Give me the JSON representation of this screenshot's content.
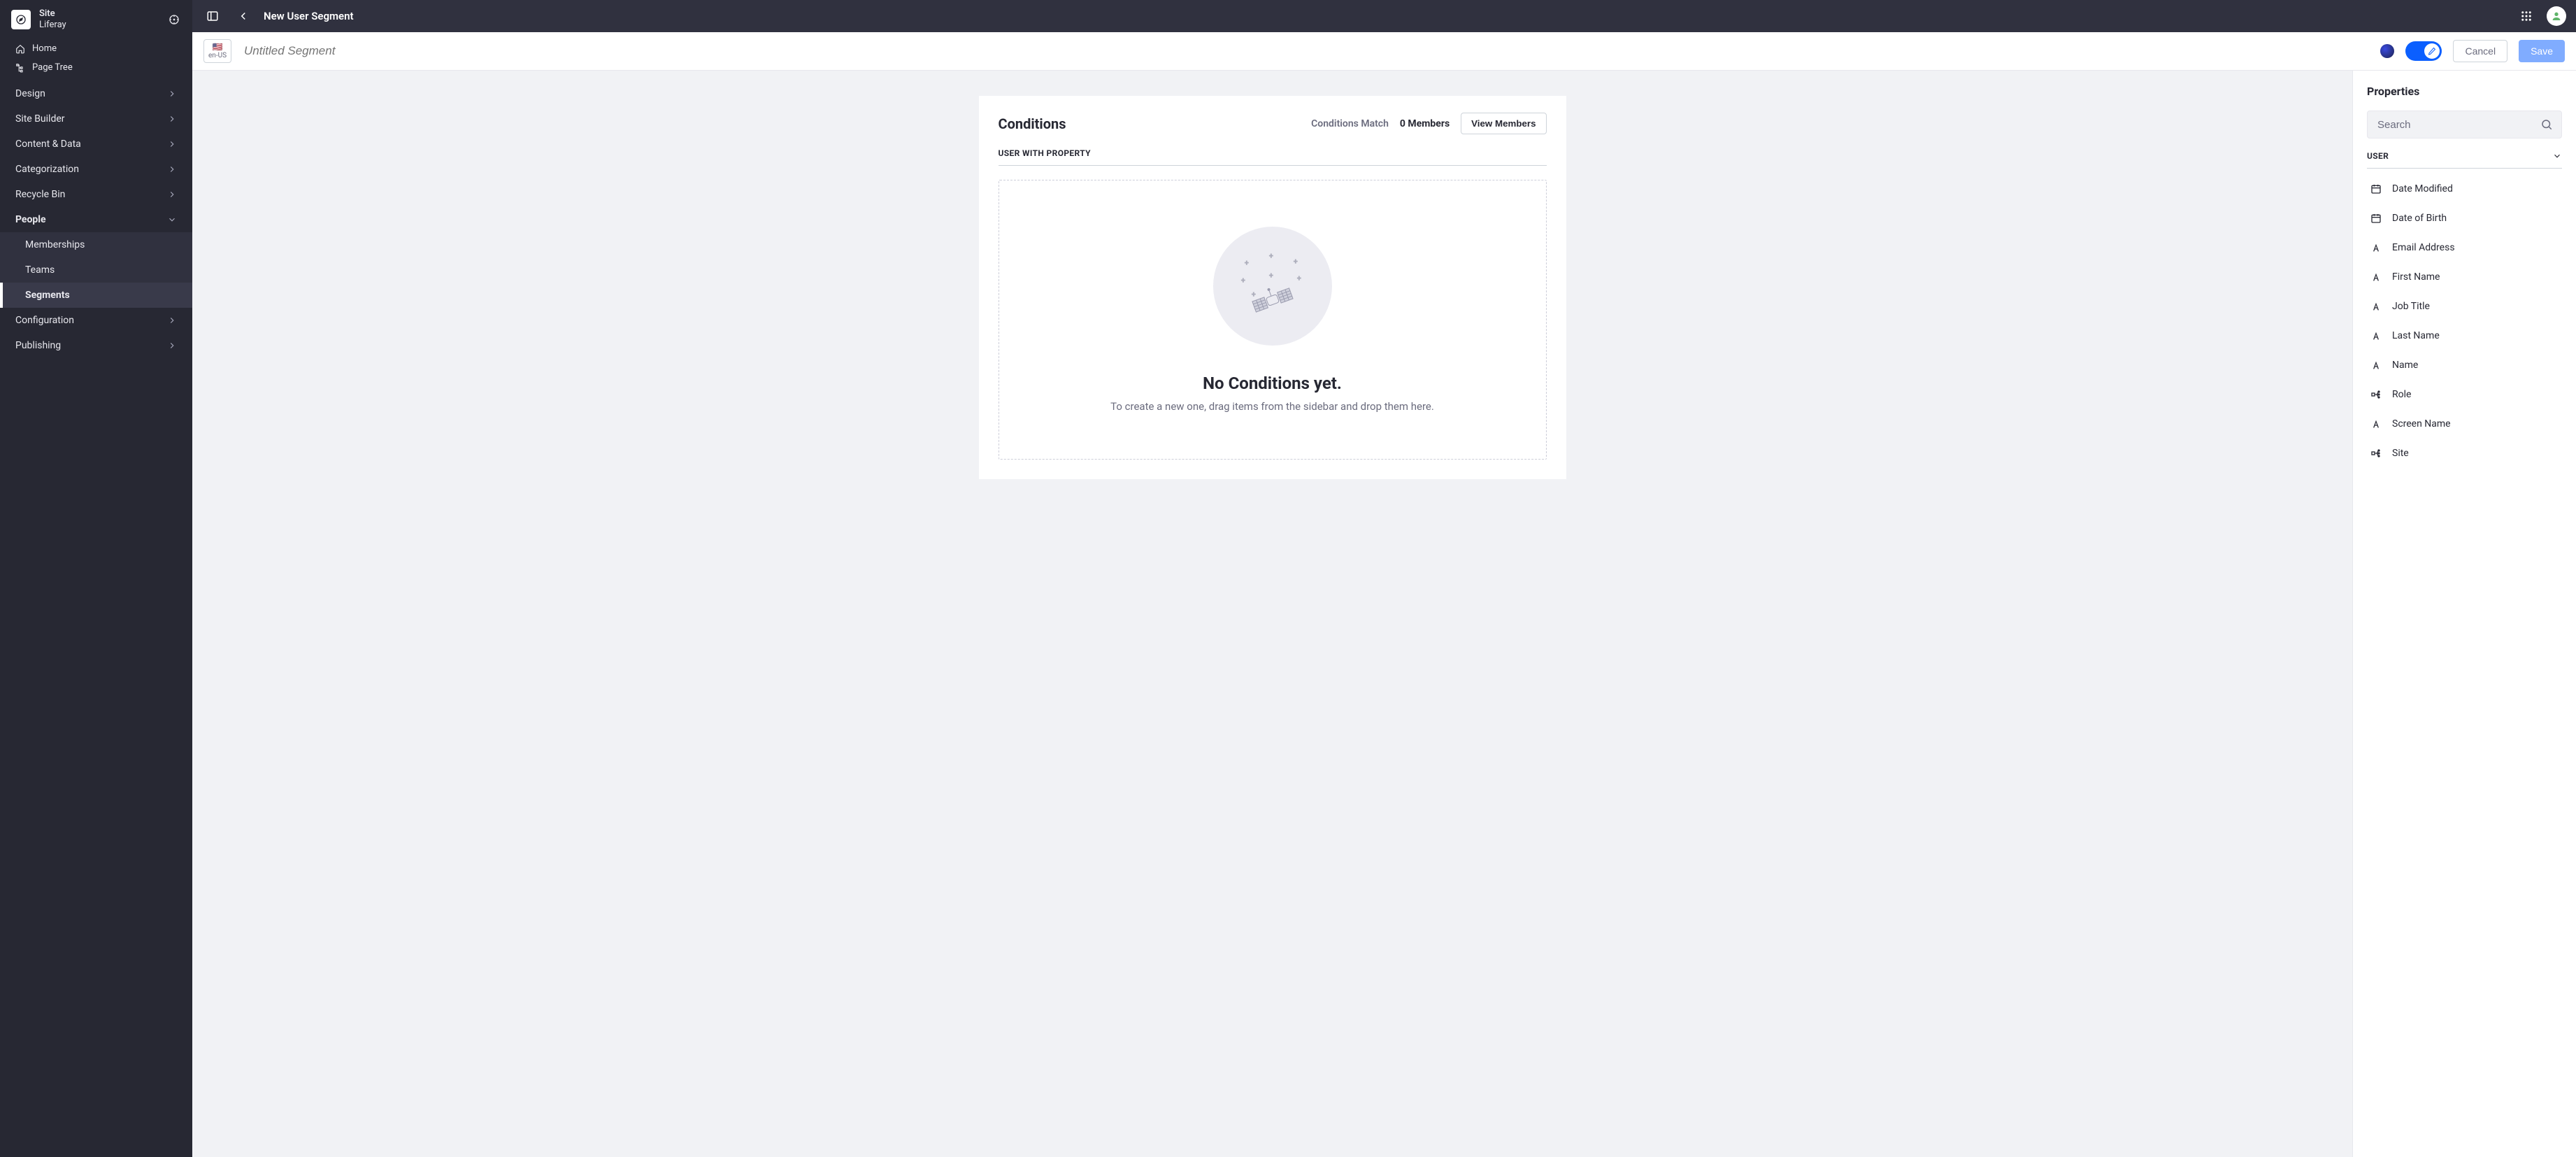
{
  "site": {
    "label": "Site",
    "name": "Liferay"
  },
  "sidebar": {
    "quick": {
      "home": "Home",
      "page_tree": "Page Tree"
    },
    "items": [
      {
        "label": "Design"
      },
      {
        "label": "Site Builder"
      },
      {
        "label": "Content & Data"
      },
      {
        "label": "Categorization"
      },
      {
        "label": "Recycle Bin"
      },
      {
        "label": "People",
        "children": [
          {
            "label": "Memberships"
          },
          {
            "label": "Teams"
          },
          {
            "label": "Segments",
            "active": true
          }
        ]
      },
      {
        "label": "Configuration"
      },
      {
        "label": "Publishing"
      }
    ]
  },
  "topbar": {
    "title": "New User Segment"
  },
  "actionbar": {
    "locale_code": "en-US",
    "segment_title_placeholder": "Untitled Segment",
    "cancel": "Cancel",
    "save": "Save"
  },
  "conditions": {
    "title": "Conditions",
    "match_label": "Conditions Match",
    "match_count": "0 Members",
    "view_members": "View Members",
    "section_label": "USER WITH PROPERTY",
    "empty_title": "No Conditions yet.",
    "empty_sub": "To create a new one, drag items from the sidebar and drop them here."
  },
  "properties": {
    "title": "Properties",
    "search_placeholder": "Search",
    "group_label": "USER",
    "items": [
      {
        "label": "Date Modified",
        "icon": "calendar"
      },
      {
        "label": "Date of Birth",
        "icon": "calendar"
      },
      {
        "label": "Email Address",
        "icon": "text"
      },
      {
        "label": "First Name",
        "icon": "text"
      },
      {
        "label": "Job Title",
        "icon": "text"
      },
      {
        "label": "Last Name",
        "icon": "text"
      },
      {
        "label": "Name",
        "icon": "text"
      },
      {
        "label": "Role",
        "icon": "relation"
      },
      {
        "label": "Screen Name",
        "icon": "text"
      },
      {
        "label": "Site",
        "icon": "relation"
      }
    ]
  }
}
